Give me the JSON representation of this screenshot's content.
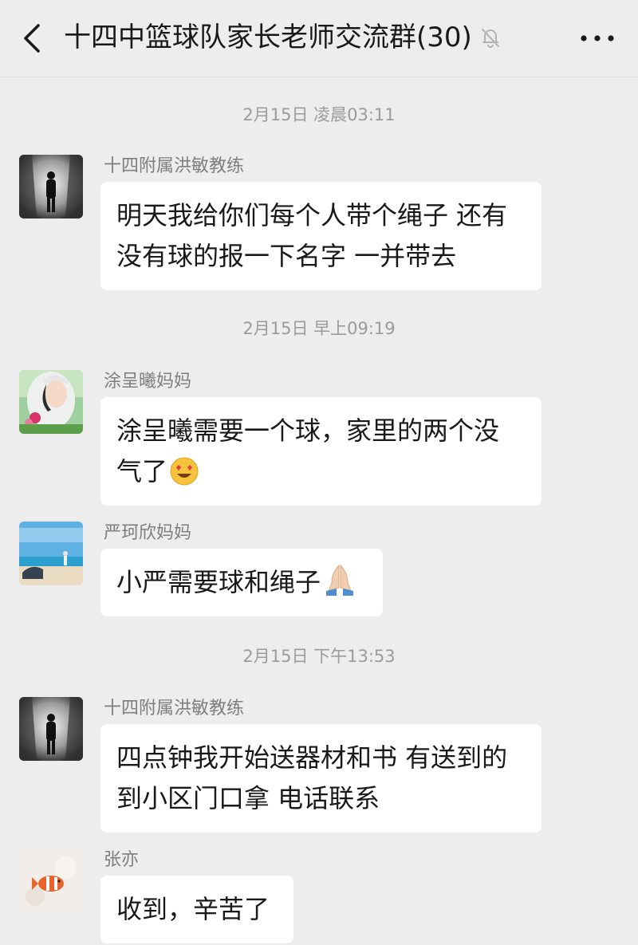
{
  "header": {
    "title": "十四中篮球队家长老师交流群(30)",
    "back_icon": "chevron-left-icon",
    "mute_icon": "bell-off-icon",
    "more_icon": "more-dots-icon"
  },
  "time_separators": [
    "2月15日 凌晨03:11",
    "2月15日 早上09:19",
    "2月15日 下午13:53"
  ],
  "messages": [
    {
      "sender": "十四附属洪敏教练",
      "text_line1": "明天我给你们每个人带个绳子 还有",
      "text_line2": "没有球的报一下名字 一并带去"
    },
    {
      "sender": "涂呈曦妈妈",
      "text_line1": "涂呈曦需要一个球，家里的两个没",
      "text_line2": "气了",
      "emoji": "smiling-face-with-heart-eyes-emoji"
    },
    {
      "sender": "严珂欣妈妈",
      "text_line1": "小严需要球和绳子",
      "emoji": "folded-hands-emoji"
    },
    {
      "sender": "十四附属洪敏教练",
      "text_line1": "四点钟我开始送器材和书 有送到的",
      "text_line2": "到小区门口拿 电话联系"
    },
    {
      "sender": "张亦",
      "text_line1": "收到，辛苦了"
    }
  ],
  "colors": {
    "background": "#ededed",
    "bubble": "#ffffff",
    "timestamp": "#9b9b9b",
    "sender": "#7e7e7e",
    "text": "#191919"
  }
}
